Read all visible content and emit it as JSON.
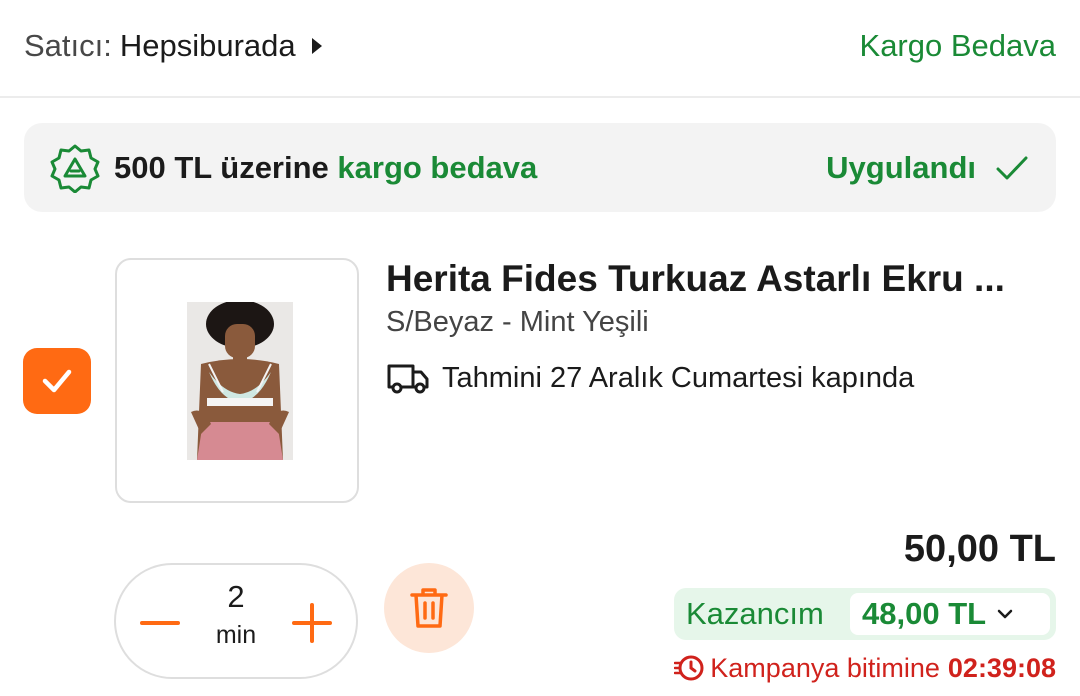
{
  "seller": {
    "prefix": "Satıcı:",
    "name": "Hepsiburada",
    "shipping_label": "Kargo Bedava"
  },
  "promo": {
    "text_prefix": "500 TL üzerine ",
    "text_highlight": "kargo bedava",
    "status": "Uygulandı",
    "icon": "discount-tag-icon"
  },
  "product": {
    "selected": true,
    "title": "Herita Fides Turkuaz Astarlı Ekru ...",
    "variant": "S/Beyaz - Mint Yeşili",
    "delivery": "Tahmini 27 Aralık Cumartesi kapında",
    "price": "50,00 TL",
    "quantity": "2",
    "quantity_unit": "min"
  },
  "savings": {
    "label": "Kazancım",
    "amount": "48,00 TL"
  },
  "campaign": {
    "label": "Kampanya bitimine",
    "time": "02:39:08"
  },
  "colors": {
    "accent_orange": "#ff6a13",
    "green": "#1a8a36",
    "red": "#d0221c",
    "promo_bg": "#f3f3f3",
    "savings_bg": "#e6f6ea"
  }
}
